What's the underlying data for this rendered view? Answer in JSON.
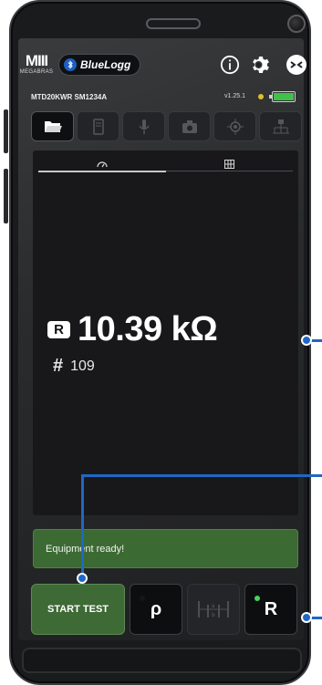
{
  "header": {
    "brand_bars": "MIII",
    "brand_word": "MEGABRAS",
    "app_name": "BlueLogg",
    "device": "MTD20KWR SM1234A",
    "version": "v1.25.1"
  },
  "toolbar": {
    "items": [
      "folder-icon",
      "file-icon",
      "microphone-icon",
      "camera-icon",
      "gps-icon",
      "wiring-icon"
    ]
  },
  "measurement": {
    "mode_badge": "R",
    "value": "10.39 kΩ",
    "hash": "#",
    "count": "109"
  },
  "status": {
    "text": "Equipment ready!"
  },
  "controls": {
    "start_label": "START TEST",
    "rho_label": "ρ",
    "r_label": "R"
  },
  "colors": {
    "accent_green": "#3d6a35",
    "callout_blue": "#1f67c6",
    "battery_green": "#3fc247",
    "status_yellow": "#e0c029"
  }
}
